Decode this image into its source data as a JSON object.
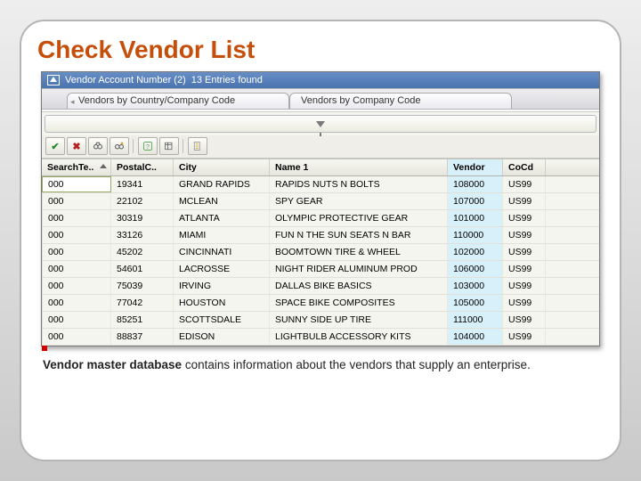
{
  "title": "Check Vendor List",
  "header": {
    "label": "Vendor Account Number (2)",
    "count_text": "13 Entries found"
  },
  "tabs": [
    {
      "label": "Vendors by Country/Company Code"
    },
    {
      "label": "Vendors by Company Code"
    }
  ],
  "toolbar_icons": {
    "ok": "ok-check-icon",
    "cancel": "cancel-x-icon",
    "find": "binoculars-icon",
    "find_next": "binoculars-plus-icon",
    "separator1": "",
    "help": "help-icon",
    "layout": "layout-icon",
    "separator2": "",
    "personal": "personal-list-icon"
  },
  "columns": {
    "search_term": "SearchTe..",
    "postal_code": "PostalC..",
    "city": "City",
    "name1": "Name 1",
    "vendor": "Vendor",
    "cocd": "CoCd"
  },
  "rows": [
    {
      "search": "000",
      "postal": "19341",
      "city": "GRAND RAPIDS",
      "name1": "RAPIDS NUTS N BOLTS",
      "vendor": "108000",
      "cocd": "US99"
    },
    {
      "search": "000",
      "postal": "22102",
      "city": "MCLEAN",
      "name1": "SPY GEAR",
      "vendor": "107000",
      "cocd": "US99"
    },
    {
      "search": "000",
      "postal": "30319",
      "city": "ATLANTA",
      "name1": "OLYMPIC PROTECTIVE GEAR",
      "vendor": "101000",
      "cocd": "US99"
    },
    {
      "search": "000",
      "postal": "33126",
      "city": "MIAMI",
      "name1": "FUN N THE SUN SEATS N BAR",
      "vendor": "110000",
      "cocd": "US99"
    },
    {
      "search": "000",
      "postal": "45202",
      "city": "CINCINNATI",
      "name1": "BOOMTOWN TIRE & WHEEL",
      "vendor": "102000",
      "cocd": "US99"
    },
    {
      "search": "000",
      "postal": "54601",
      "city": "LACROSSE",
      "name1": "NIGHT RIDER ALUMINUM PROD",
      "vendor": "106000",
      "cocd": "US99"
    },
    {
      "search": "000",
      "postal": "75039",
      "city": "IRVING",
      "name1": "DALLAS BIKE BASICS",
      "vendor": "103000",
      "cocd": "US99"
    },
    {
      "search": "000",
      "postal": "77042",
      "city": "HOUSTON",
      "name1": "SPACE BIKE COMPOSITES",
      "vendor": "105000",
      "cocd": "US99"
    },
    {
      "search": "000",
      "postal": "85251",
      "city": "SCOTTSDALE",
      "name1": "SUNNY SIDE UP TIRE",
      "vendor": "111000",
      "cocd": "US99"
    },
    {
      "search": "000",
      "postal": "88837",
      "city": "EDISON",
      "name1": "LIGHTBULB ACCESSORY KITS",
      "vendor": "104000",
      "cocd": "US99"
    }
  ],
  "caption": {
    "bold": "Vendor master database",
    "rest": " contains information about the vendors that supply an enterprise."
  }
}
